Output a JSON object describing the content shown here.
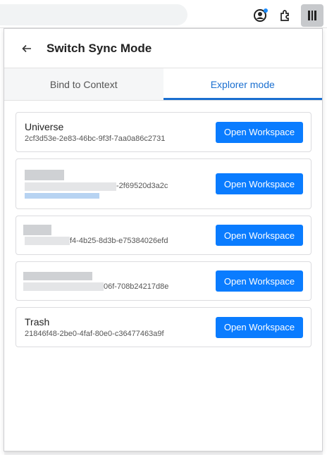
{
  "browser": {
    "toolbar_icons": [
      "account-icon",
      "extensions-icon",
      "extension-active-icon"
    ]
  },
  "popup": {
    "title": "Switch Sync Mode",
    "tabs": [
      {
        "label": "Bind to Context",
        "active": false
      },
      {
        "label": "Explorer mode",
        "active": true
      }
    ],
    "button_label": "Open Workspace",
    "accent_color": "#0a7cff",
    "workspaces": [
      {
        "name": "Universe",
        "id": "2cf3d53e-2e83-46bc-9f3f-7aa0a86c2731"
      },
      {
        "name": "",
        "id": "-2f69520d3a2c",
        "redacted": true
      },
      {
        "name": "",
        "id": "f4-4b25-8d3b-e75384026efd",
        "redacted": true
      },
      {
        "name": "",
        "id": "06f-708b24217d8e",
        "redacted": true
      },
      {
        "name": "Trash",
        "id": "21846f48-2be0-4faf-80e0-c36477463a9f"
      }
    ]
  }
}
